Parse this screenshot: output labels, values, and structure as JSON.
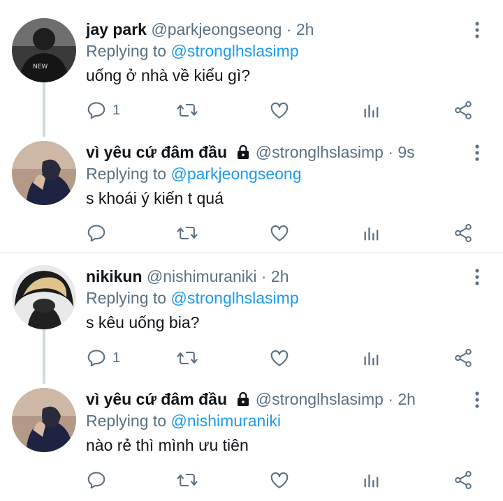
{
  "tweets": [
    {
      "name": "jay park",
      "handle": "@parkjeongseong",
      "time": "· 2h",
      "locked": false,
      "replying_prefix": "Replying to",
      "replying_to": "@stronglhslasimp",
      "text": "uống ở nhà về kiểu gì?",
      "reply_count": "1",
      "avatar": "avatar-dark-photo"
    },
    {
      "name": "vì yêu cứ đâm đầu",
      "handle": "@stronglhslasimp",
      "time": "· 9s",
      "locked": true,
      "replying_prefix": "Replying to",
      "replying_to": "@parkjeongseong",
      "text": "s khoái ý kiến t quá",
      "reply_count": "",
      "avatar": "avatar-hand-photo"
    },
    {
      "name": "nikikun",
      "handle": "@nishimuraniki",
      "time": "· 2h",
      "locked": false,
      "replying_prefix": "Replying to",
      "replying_to": "@stronglhslasimp",
      "text": "s kêu uống bia?",
      "reply_count": "1",
      "avatar": "avatar-blond-photo"
    },
    {
      "name": "vì yêu cứ đâm đầu",
      "handle": "@stronglhslasimp",
      "time": "· 2h",
      "locked": true,
      "replying_prefix": "Replying to",
      "replying_to": "@nishimuraniki",
      "text": "nào rẻ thì mình ưu tiên",
      "reply_count": "",
      "avatar": "avatar-hand-photo"
    }
  ],
  "colors": {
    "text": "#0f1419",
    "secondary": "#5b7083",
    "accent": "#1d9bf0",
    "thread_line": "#cfd9de"
  },
  "icons": [
    "reply-icon",
    "retweet-icon",
    "like-icon",
    "analytics-icon",
    "share-icon",
    "more-icon",
    "lock-icon"
  ]
}
